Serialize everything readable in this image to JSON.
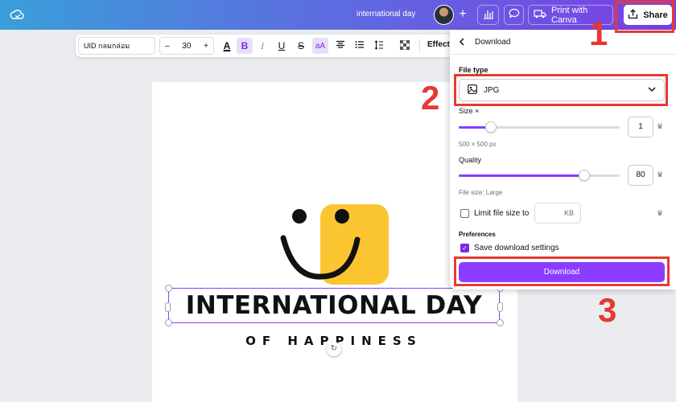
{
  "topbar": {
    "doc_title": "international day",
    "plus": "+",
    "print_label": "Print with Canva",
    "share_label": "Share",
    "gradient": [
      "#3a9fd8",
      "#7b3fe4"
    ]
  },
  "toolbar": {
    "font_name": "UID กลมกล่อม",
    "size_minus": "–",
    "font_size": "30",
    "size_plus": "+",
    "text_color_glyph": "A",
    "bold_glyph": "B",
    "italic_glyph": "I",
    "underline_glyph": "U",
    "strike_glyph": "S",
    "case_glyph": "aA",
    "effects_label": "Effects"
  },
  "canvas": {
    "headline": "INTERNATIONAL DAY",
    "subline": "OF HAPPINESS"
  },
  "download_panel": {
    "title": "Download",
    "file_type_label": "File type",
    "file_type_value": "JPG",
    "size_label": "Size ×",
    "size_value": "1",
    "size_fraction": 0.05,
    "size_dims": "500 × 500 px",
    "quality_label": "Quality",
    "quality_value": "80",
    "quality_fraction": 0.78,
    "file_size_hint": "File size: Large",
    "limit_label": "Limit file size to",
    "kb_unit": "KB",
    "preferences_label": "Preferences",
    "save_settings_label": "Save download settings",
    "save_settings_checked": true,
    "download_button": "Download",
    "accent_color": "#8b3dff"
  },
  "annotations": {
    "step1": "1",
    "step2": "2",
    "step3": "3",
    "color": "#e53935"
  },
  "icons": {
    "cloud": "cloud-check-icon",
    "analytics": "bar-chart-icon",
    "comment": "speech-bubble-icon",
    "truck": "truck-icon",
    "share": "upload-icon",
    "image": "image-icon",
    "back": "chevron-left-icon",
    "crown": "crown-icon"
  }
}
